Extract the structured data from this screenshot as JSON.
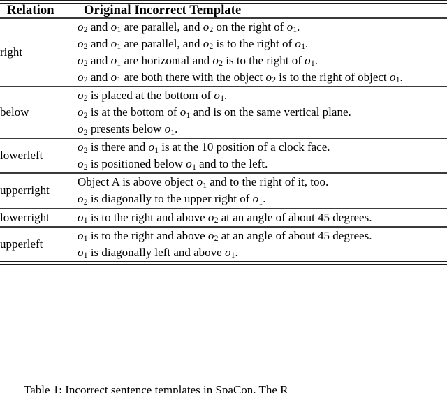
{
  "table": {
    "columns": [
      {
        "key": "relation",
        "header": "Relation"
      },
      {
        "key": "template",
        "header": "Original Incorrect Template"
      }
    ],
    "rows": [
      {
        "relation": "right",
        "templates": [
          "o₂ and o₁ are parallel, and o₂ on the right of o₁.",
          "o₂ and o₁ are parallel, and o₂ is to the right of o₁.",
          "o₂ and o₁ are horizontal and o₂ is to the right of o₁.",
          "o₂ and o₁ are both there with the object o₂ is to the right of object o₁."
        ]
      },
      {
        "relation": "below",
        "templates": [
          "o₂ is placed at the bottom of o₁.",
          "o₂ is at the bottom of o₁ and is on the same vertical plane.",
          "o₂ presents below o₁."
        ]
      },
      {
        "relation": "lowerleft",
        "templates": [
          "o₂ is there and o₁ is at the 10 position of a clock face.",
          "o₂ is positioned below o₁ and to the left."
        ]
      },
      {
        "relation": "upperright",
        "templates": [
          "Object A is above object o₁ and to the right of it, too.",
          "o₂ is diagonally to the upper right of o₁."
        ]
      },
      {
        "relation": "lowerright",
        "templates": [
          "o₁ is to the right and above o₂ at an angle of about 45 degrees."
        ]
      },
      {
        "relation": "upperleft",
        "templates": [
          "o₁ is to the right and above o₂ at an angle of about 45 degrees.",
          "o₁ is diagonally left and above o₁."
        ]
      }
    ]
  },
  "caption": {
    "label": "Table 1:",
    "text": "Incorrect sentence templates in SpaCon. The R"
  },
  "colors": {
    "rule": "#1a1a1a",
    "text": "#000000",
    "background": "#ffffff"
  }
}
